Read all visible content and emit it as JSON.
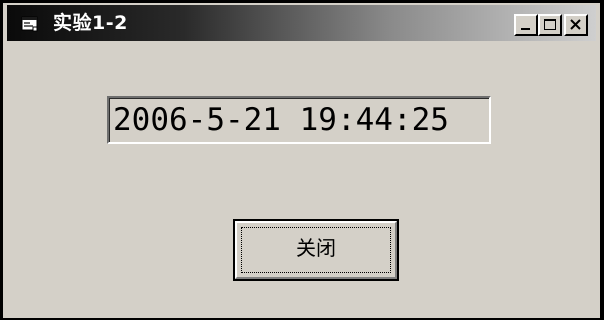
{
  "window": {
    "title": "实验1-2",
    "icon": "form-app-icon",
    "controls": {
      "minimize": "minimize-icon",
      "maximize": "maximize-icon",
      "close": "close-icon"
    }
  },
  "main": {
    "datetime_text": "2006-5-21 19:44:25",
    "close_button_label": "关闭"
  },
  "colors": {
    "face": "#d4d0c8",
    "titlebar_start": "#0a0a0a",
    "titlebar_end": "#cfcfcf",
    "text": "#000000",
    "title_text": "#ffffff"
  }
}
